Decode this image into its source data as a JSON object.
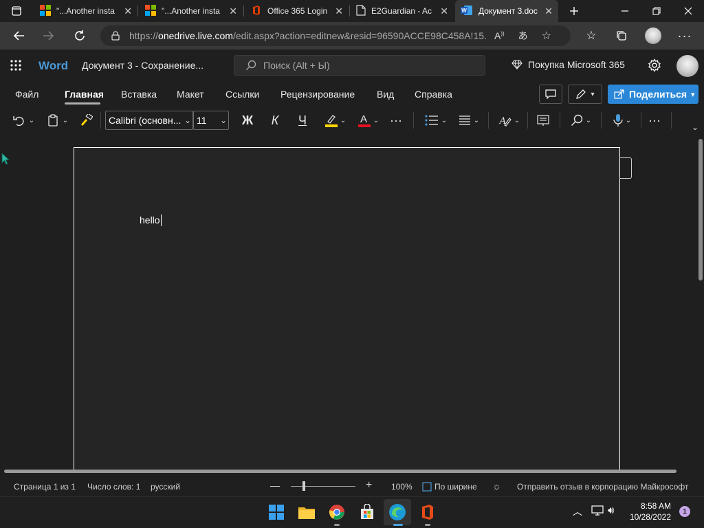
{
  "browser": {
    "tabs": [
      {
        "title": "\"...Another insta",
        "icon": "microsoft-logo-icon"
      },
      {
        "title": "\"...Another insta",
        "icon": "microsoft-logo-icon"
      },
      {
        "title": "Office 365 Login",
        "icon": "office-icon"
      },
      {
        "title": "E2Guardian - Ac",
        "icon": "page-icon"
      },
      {
        "title": "Документ 3.doc",
        "icon": "word-icon",
        "active": true
      }
    ],
    "url_prefix": "https://",
    "url_host": "onedrive.live.com",
    "url_path": "/edit.aspx?action=editnew&resid=96590ACCE98C458A!15..."
  },
  "word": {
    "app_name": "Word",
    "doc_title": "Документ 3  -  Сохранение...",
    "search_placeholder": "Поиск (Alt + Ы)",
    "buy_label": "Покупка Microsoft 365",
    "ribbon_tabs": [
      "Файл",
      "Главная",
      "Вставка",
      "Макет",
      "Ссылки",
      "Рецензирование",
      "Вид",
      "Справка"
    ],
    "share_label": "Поделиться",
    "font_name": "Calibri (основн...",
    "font_size": "11",
    "bold_glyph": "Ж",
    "italic_glyph": "К",
    "underline_glyph": "Ч",
    "doc_text": "hello"
  },
  "status": {
    "page": "Страница 1 из 1",
    "words": "Число слов: 1",
    "language": "русский",
    "zoom": "100%",
    "fit": "По ширине",
    "feedback": "Отправить отзыв в корпорацию Майкрософт"
  },
  "taskbar": {
    "time": "8:58 AM",
    "date": "10/28/2022",
    "notifications": "1"
  },
  "colors": {
    "accent": "#2b88d8",
    "highlight": "#ffd400",
    "font_color": "#e81123",
    "word_blue": "#4a9ad8"
  }
}
